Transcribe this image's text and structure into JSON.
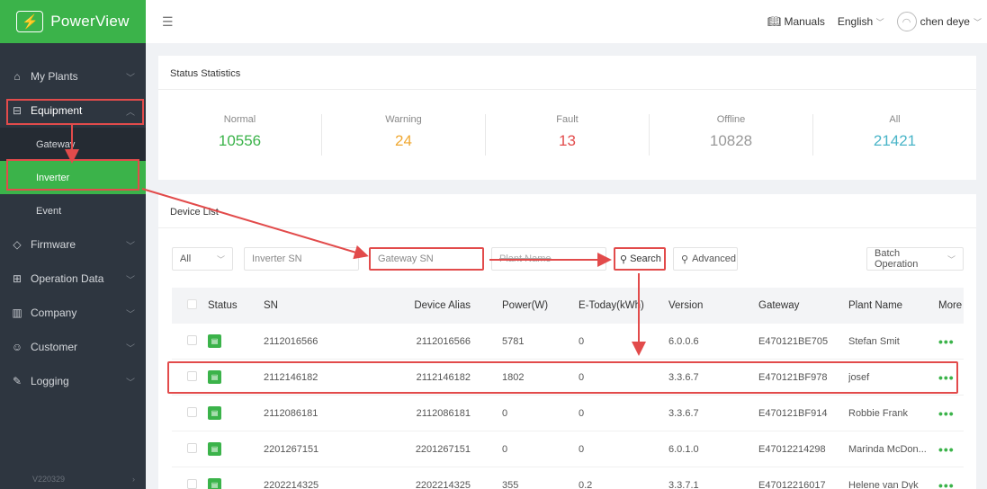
{
  "app": {
    "logo_text": "PowerView",
    "version": "V220329"
  },
  "header": {
    "manuals": "Manuals",
    "language": "English",
    "user": "chen deye"
  },
  "sidebar": {
    "items": [
      {
        "label": "My Plants",
        "icon": "home-icon"
      },
      {
        "label": "Equipment",
        "icon": "equipment-icon"
      },
      {
        "label": "Firmware",
        "icon": "firmware-icon"
      },
      {
        "label": "Operation Data",
        "icon": "grid-icon"
      },
      {
        "label": "Company",
        "icon": "company-icon"
      },
      {
        "label": "Customer",
        "icon": "customer-icon"
      },
      {
        "label": "Logging",
        "icon": "logging-icon"
      }
    ],
    "equipment_sub": [
      "Gateway",
      "Inverter",
      "Event"
    ]
  },
  "status": {
    "title": "Status Statistics",
    "stats": [
      {
        "label": "Normal",
        "value": "10556",
        "color": "#3bb34a"
      },
      {
        "label": "Warning",
        "value": "24",
        "color": "#f0a832"
      },
      {
        "label": "Fault",
        "value": "13",
        "color": "#e24b4b"
      },
      {
        "label": "Offline",
        "value": "10828",
        "color": "#999999"
      },
      {
        "label": "All",
        "value": "21421",
        "color": "#4ab5c8"
      }
    ]
  },
  "device_list": {
    "title": "Device List",
    "filters": {
      "type_value": "All",
      "inverter_sn_placeholder": "Inverter SN",
      "gateway_sn_placeholder": "Gateway SN",
      "plant_name_placeholder": "Plant Name",
      "search_label": "Search",
      "advanced_label": "Advanced",
      "batch_label": "Batch Operation"
    },
    "columns": [
      "Status",
      "SN",
      "Device Alias",
      "Power(W)",
      "E-Today(kWh)",
      "Version",
      "Gateway",
      "Plant Name",
      "More"
    ],
    "rows": [
      {
        "sn": "2112016566",
        "alias": "2112016566",
        "power": "5781",
        "etoday": "0",
        "version": "6.0.0.6",
        "gateway": "E470121BE705",
        "plant": "Stefan Smit"
      },
      {
        "sn": "2112146182",
        "alias": "2112146182",
        "power": "1802",
        "etoday": "0",
        "version": "3.3.6.7",
        "gateway": "E470121BF978",
        "plant": "josef"
      },
      {
        "sn": "2112086181",
        "alias": "2112086181",
        "power": "0",
        "etoday": "0",
        "version": "3.3.6.7",
        "gateway": "E470121BF914",
        "plant": "Robbie Frank"
      },
      {
        "sn": "2201267151",
        "alias": "2201267151",
        "power": "0",
        "etoday": "0",
        "version": "6.0.1.0",
        "gateway": "E47012214298",
        "plant": "Marinda McDon..."
      },
      {
        "sn": "2202214325",
        "alias": "2202214325",
        "power": "355",
        "etoday": "0.2",
        "version": "3.3.7.1",
        "gateway": "E47012216017",
        "plant": "Helene van Dyk"
      }
    ],
    "more_glyph": "•••"
  },
  "colors": {
    "brand": "#3bb34a",
    "sidebar_bg": "#2e3640",
    "annotation": "#e24b4b"
  }
}
